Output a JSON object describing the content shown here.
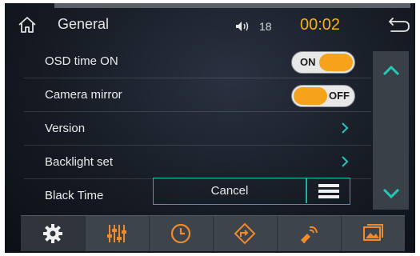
{
  "header": {
    "title": "General",
    "volume": "18",
    "clock": "00:02"
  },
  "settings_list": [
    {
      "label": "OSD time ON",
      "control": "toggle",
      "state": "ON"
    },
    {
      "label": "Camera mirror",
      "control": "toggle",
      "state": "OFF"
    },
    {
      "label": "Version",
      "control": "chevron"
    },
    {
      "label": "Backlight set",
      "control": "chevron"
    },
    {
      "label": "Black Time",
      "control": "select"
    }
  ],
  "black_time_popup": {
    "button_label": "Cancel"
  },
  "bottom_tabs": [
    {
      "icon": "gear-icon",
      "selected": true
    },
    {
      "icon": "equalizer-icon",
      "selected": false
    },
    {
      "icon": "clock-icon",
      "selected": false
    },
    {
      "icon": "navigation-icon",
      "selected": false
    },
    {
      "icon": "satellite-icon",
      "selected": false
    },
    {
      "icon": "wallpaper-icon",
      "selected": false
    }
  ],
  "colors": {
    "accent_orange": "#f6a21a",
    "clock_yellow": "#f2b414",
    "teal": "#1fb0a4",
    "scroll_arrow": "#26c6b8"
  }
}
